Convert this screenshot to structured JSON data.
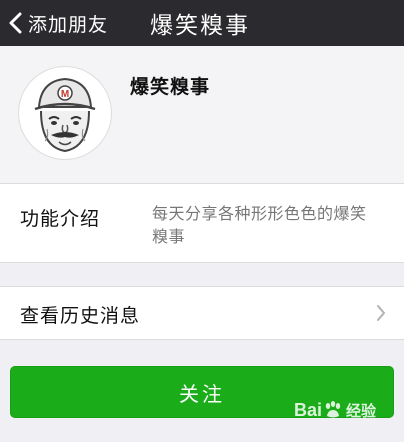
{
  "navbar": {
    "back_label": "添加朋友",
    "title": "爆笑糗事"
  },
  "profile": {
    "name": "爆笑糗事",
    "avatar": "cartoon-face-with-cap"
  },
  "intro": {
    "label": "功能介绍",
    "text": "每天分享各种形形色色的爆笑糗事"
  },
  "history": {
    "label": "查看历史消息"
  },
  "follow_button": {
    "label": "关注"
  },
  "watermark": {
    "brand": "Bai",
    "brand_tail": "经验"
  },
  "colors": {
    "navbar": "#2b2a2f",
    "background": "#efeff4",
    "accent_green": "#1aad19"
  }
}
